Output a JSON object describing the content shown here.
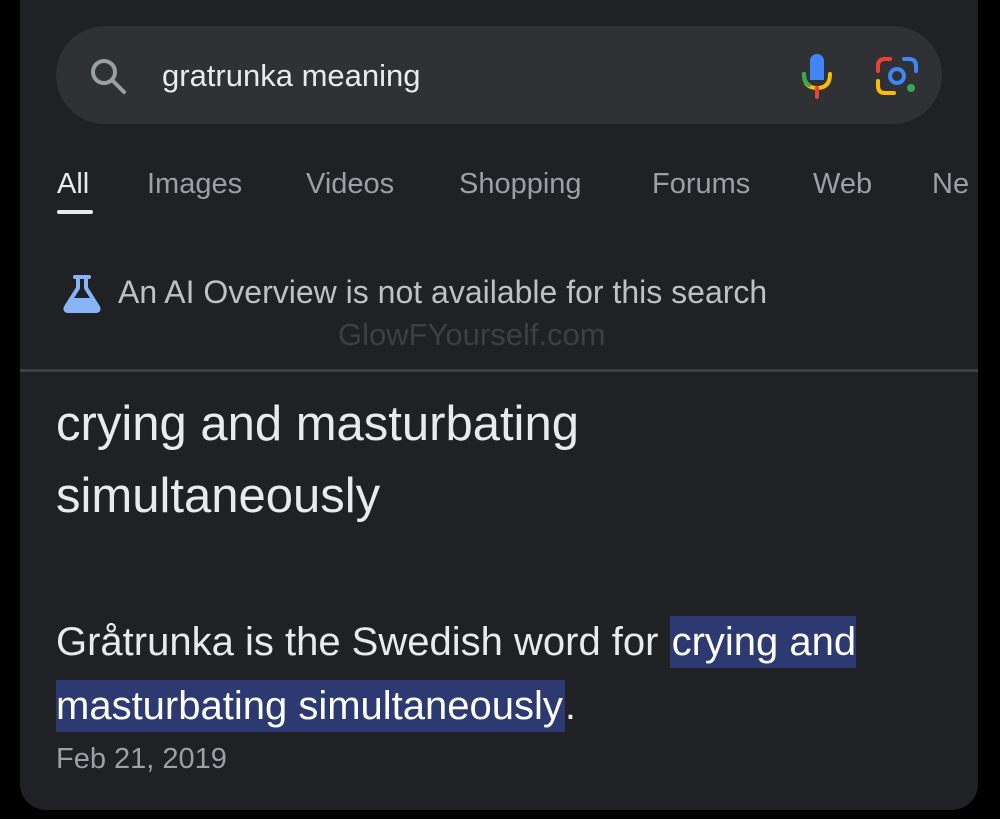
{
  "search": {
    "query": "gratrunka meaning"
  },
  "tabs": [
    {
      "label": "All",
      "active": true
    },
    {
      "label": "Images"
    },
    {
      "label": "Videos"
    },
    {
      "label": "Shopping"
    },
    {
      "label": "Forums"
    },
    {
      "label": "Web"
    },
    {
      "label": "Ne"
    }
  ],
  "ai_overview": {
    "message": "An AI Overview is not available for this search"
  },
  "watermark": "GlowFYourself.com",
  "result": {
    "title": "crying and masturbating simultaneously",
    "snippet_prefix": "Gråtrunka is the Swedish word for ",
    "snippet_highlight": "crying and masturbating simultaneously",
    "snippet_suffix": ".",
    "date": "Feb 21, 2019"
  },
  "icons": {
    "search": "search-icon",
    "mic": "mic-icon",
    "lens": "lens-icon",
    "flask": "flask-icon"
  },
  "colors": {
    "background": "#202124",
    "search_bar": "#303134",
    "highlight": "#2d3a72",
    "flask": "#8ab4f8"
  }
}
